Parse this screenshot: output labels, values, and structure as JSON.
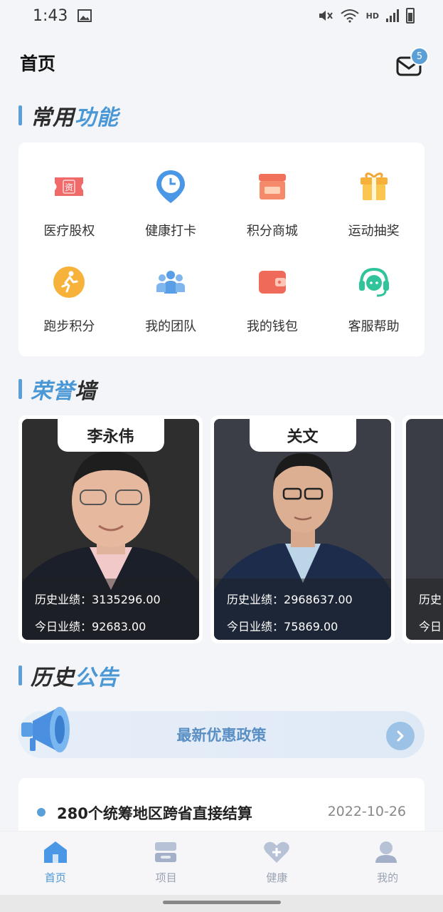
{
  "status": {
    "time": "1:43",
    "hd": "HD"
  },
  "header": {
    "title": "首页",
    "mail_badge": "5"
  },
  "sections": {
    "functions": {
      "title_dark": "常用",
      "title_blue": "功能"
    },
    "honor": {
      "title_blue": "荣誉",
      "title_dark": "墙"
    },
    "history": {
      "title_dark": "历史",
      "title_blue": "公告"
    }
  },
  "functions": [
    {
      "label": "医疗股权",
      "icon": "equity-ticket-icon"
    },
    {
      "label": "健康打卡",
      "icon": "clock-pin-icon"
    },
    {
      "label": "积分商城",
      "icon": "shop-icon"
    },
    {
      "label": "运动抽奖",
      "icon": "gift-icon"
    },
    {
      "label": "跑步积分",
      "icon": "runner-icon"
    },
    {
      "label": "我的团队",
      "icon": "team-icon"
    },
    {
      "label": "我的钱包",
      "icon": "wallet-icon"
    },
    {
      "label": "客服帮助",
      "icon": "headset-icon"
    }
  ],
  "honor_cards": [
    {
      "name": "李永伟",
      "history_label": "历史业绩：",
      "history_value": "3135296.00",
      "today_label": "今日业绩：",
      "today_value": "92683.00"
    },
    {
      "name": "关文",
      "history_label": "历史业绩：",
      "history_value": "2968637.00",
      "today_label": "今日业绩：",
      "today_value": "75869.00"
    },
    {
      "history_label": "历史",
      "today_label": "今日"
    }
  ],
  "announce": {
    "banner_text": "最新优惠政策"
  },
  "news": [
    {
      "title": "280个统筹地区跨省直接结算",
      "date": "2022-10-26"
    }
  ],
  "tabs": [
    {
      "label": "首页",
      "icon": "home-icon",
      "active": true
    },
    {
      "label": "项目",
      "icon": "project-icon",
      "active": false
    },
    {
      "label": "健康",
      "icon": "heart-plus-icon",
      "active": false
    },
    {
      "label": "我的",
      "icon": "user-icon",
      "active": false
    }
  ],
  "colors": {
    "accent": "#4a97d6",
    "bar": "#5a9fd6",
    "tab_inactive": "#9aa3b4"
  }
}
